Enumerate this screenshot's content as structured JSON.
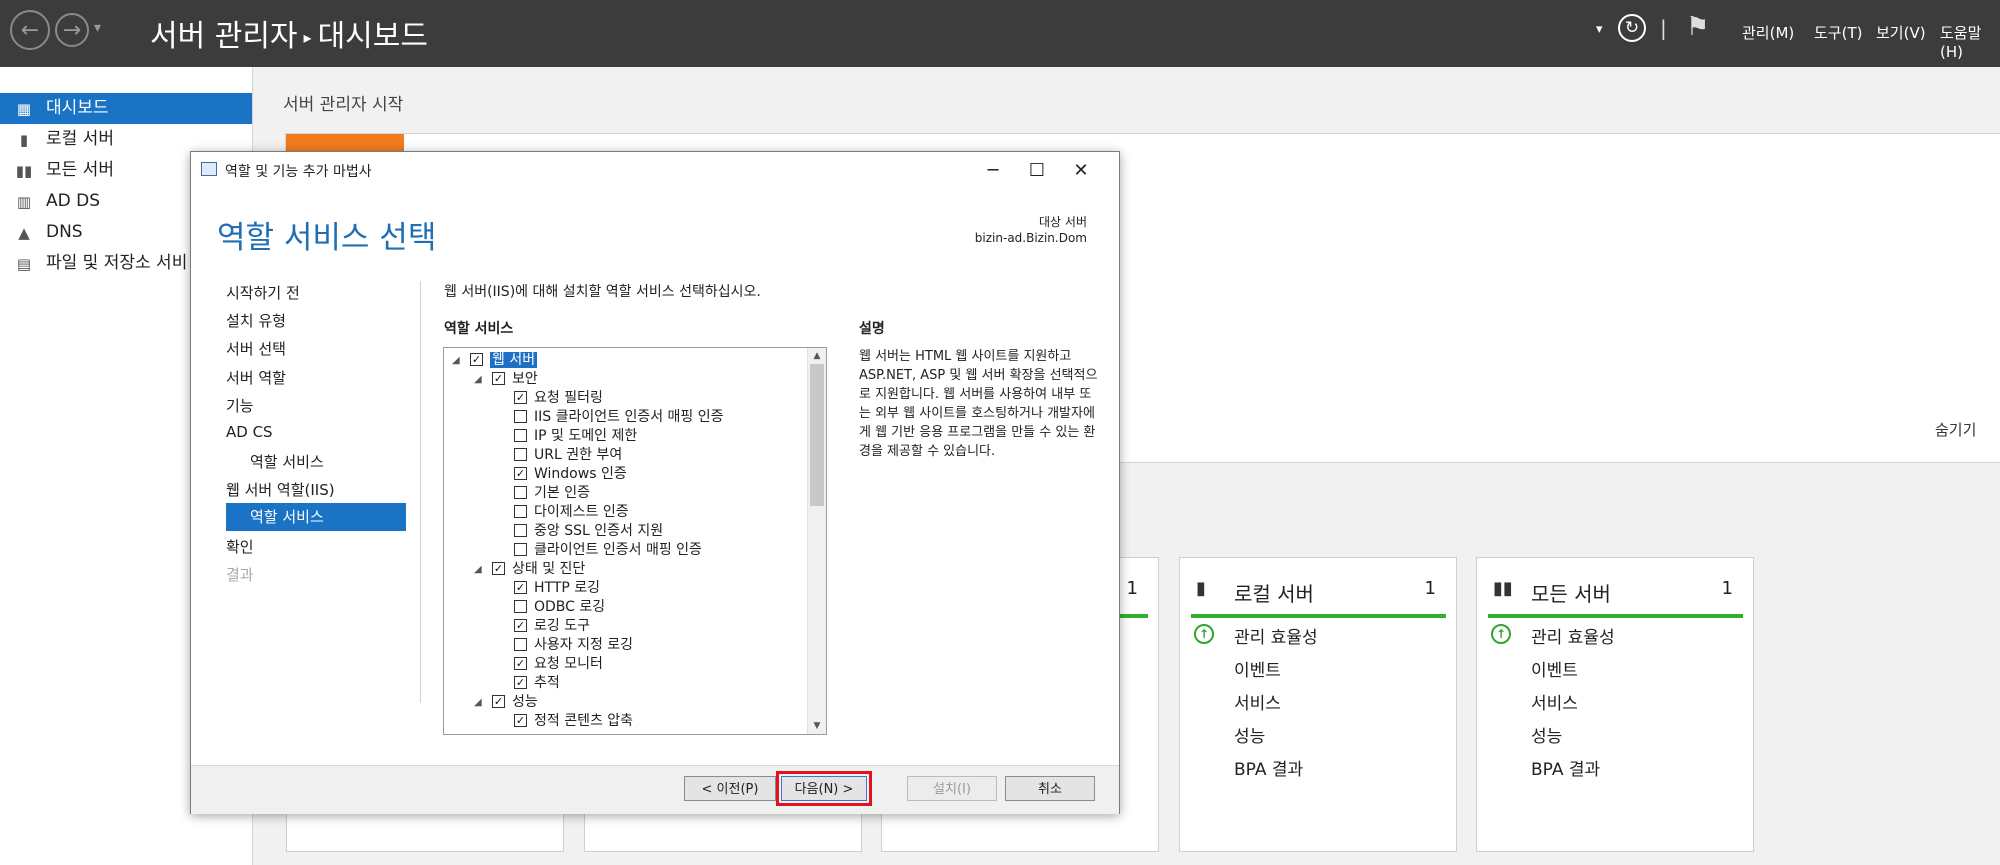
{
  "topbar": {
    "back_glyph": "←",
    "forward_glyph": "→",
    "history_glyph": "▾",
    "app_title": "서버 관리자",
    "separator": "▸",
    "page": "대시보드",
    "dropdown_glyph": "▾",
    "refresh_glyph": "↻",
    "divider_glyph": "|",
    "flag_glyph": "⚑",
    "menus": [
      "관리(M)",
      "도구(T)",
      "보기(V)",
      "도움말(H)"
    ]
  },
  "sidebar": {
    "items": [
      {
        "label": "대시보드",
        "icon": "dashboard-icon",
        "glyph": "▦"
      },
      {
        "label": "로컬 서버",
        "icon": "local-server-icon",
        "glyph": "▮"
      },
      {
        "label": "모든 서버",
        "icon": "all-servers-icon",
        "glyph": "▮▮"
      },
      {
        "label": "AD DS",
        "icon": "ad-ds-icon",
        "glyph": "▥"
      },
      {
        "label": "DNS",
        "icon": "dns-icon",
        "glyph": "▲"
      },
      {
        "label": "파일 및 저장소 서비",
        "icon": "file-storage-icon",
        "glyph": "▤"
      }
    ]
  },
  "main": {
    "title": "서버 관리자 시작",
    "hide_link": "숨기기"
  },
  "tiles": [
    {
      "title": "",
      "count": "1",
      "icon_glyph": "",
      "rows": []
    },
    {
      "title": "로컬 서버",
      "count": "1",
      "icon_glyph": "▮",
      "rows": [
        "관리 효율성",
        "이벤트",
        "서비스",
        "성능",
        "BPA 결과"
      ]
    },
    {
      "title": "모든 서버",
      "count": "1",
      "icon_glyph": "▮▮",
      "rows": [
        "관리 효율성",
        "이벤트",
        "서비스",
        "성능",
        "BPA 결과"
      ]
    }
  ],
  "dialog": {
    "window_title": "역할 및 기능 추가 마법사",
    "window_buttons": {
      "minimize": "─",
      "maximize": "☐",
      "close": "✕"
    },
    "heading": "역할 서비스 선택",
    "target_label": "대상 서버",
    "target_value": "bizin-ad.Bizin.Dom",
    "instruction": "웹 서버(IIS)에 대해 설치할 역할 서비스 선택하십시오.",
    "role_services_label": "역할 서비스",
    "description_label": "설명",
    "description": "웹 서버는 HTML 웹 사이트를 지원하고 ASP.NET, ASP 및 웹 서버 확장을 선택적으로 지원합니다. 웹 서버를 사용하여 내부 또는 외부 웹 사이트를 호스팅하거나 개발자에게 웹 기반 응용 프로그램을 만들 수 있는 환경을 제공할 수 있습니다.",
    "steps": [
      {
        "label": "시작하기 전",
        "state": "normal"
      },
      {
        "label": "설치 유형",
        "state": "normal"
      },
      {
        "label": "서버 선택",
        "state": "normal"
      },
      {
        "label": "서버 역할",
        "state": "normal"
      },
      {
        "label": "기능",
        "state": "normal"
      },
      {
        "label": "AD CS",
        "state": "normal"
      },
      {
        "label": "역할 서비스",
        "state": "sub"
      },
      {
        "label": "웹 서버 역할(IIS)",
        "state": "normal"
      },
      {
        "label": "역할 서비스",
        "state": "current"
      },
      {
        "label": "확인",
        "state": "normal"
      },
      {
        "label": "결과",
        "state": "disabled"
      }
    ],
    "tree": [
      {
        "label": "웹 서버",
        "level": 0,
        "expander": "◢",
        "checked": true,
        "selected": true
      },
      {
        "label": "보안",
        "level": 1,
        "expander": "◢",
        "checked": true
      },
      {
        "label": "요청 필터링",
        "level": 2,
        "checked": true
      },
      {
        "label": "IIS 클라이언트 인증서 매핑 인증",
        "level": 2,
        "checked": false
      },
      {
        "label": "IP 및 도메인 제한",
        "level": 2,
        "checked": false
      },
      {
        "label": "URL 권한 부여",
        "level": 2,
        "checked": false
      },
      {
        "label": "Windows 인증",
        "level": 2,
        "checked": true
      },
      {
        "label": "기본 인증",
        "level": 2,
        "checked": false
      },
      {
        "label": "다이제스트 인증",
        "level": 2,
        "checked": false
      },
      {
        "label": "중앙 SSL 인증서 지원",
        "level": 2,
        "checked": false
      },
      {
        "label": "클라이언트 인증서 매핑 인증",
        "level": 2,
        "checked": false
      },
      {
        "label": "상태 및 진단",
        "level": 1,
        "expander": "◢",
        "checked": true
      },
      {
        "label": "HTTP 로깅",
        "level": 2,
        "checked": true
      },
      {
        "label": "ODBC 로깅",
        "level": 2,
        "checked": false
      },
      {
        "label": "로깅 도구",
        "level": 2,
        "checked": true
      },
      {
        "label": "사용자 지정 로깅",
        "level": 2,
        "checked": false
      },
      {
        "label": "요청 모니터",
        "level": 2,
        "checked": true
      },
      {
        "label": "추적",
        "level": 2,
        "checked": true
      },
      {
        "label": "성능",
        "level": 1,
        "expander": "◢",
        "checked": true
      },
      {
        "label": "정적 콘텐츠 압축",
        "level": 2,
        "checked": true
      }
    ],
    "scroll": {
      "up": "▲",
      "down": "▼"
    },
    "check_glyph": "✓",
    "buttons": {
      "prev": "< 이전(P)",
      "next": "다음(N) >",
      "install": "설치(I)",
      "cancel": "취소"
    }
  }
}
